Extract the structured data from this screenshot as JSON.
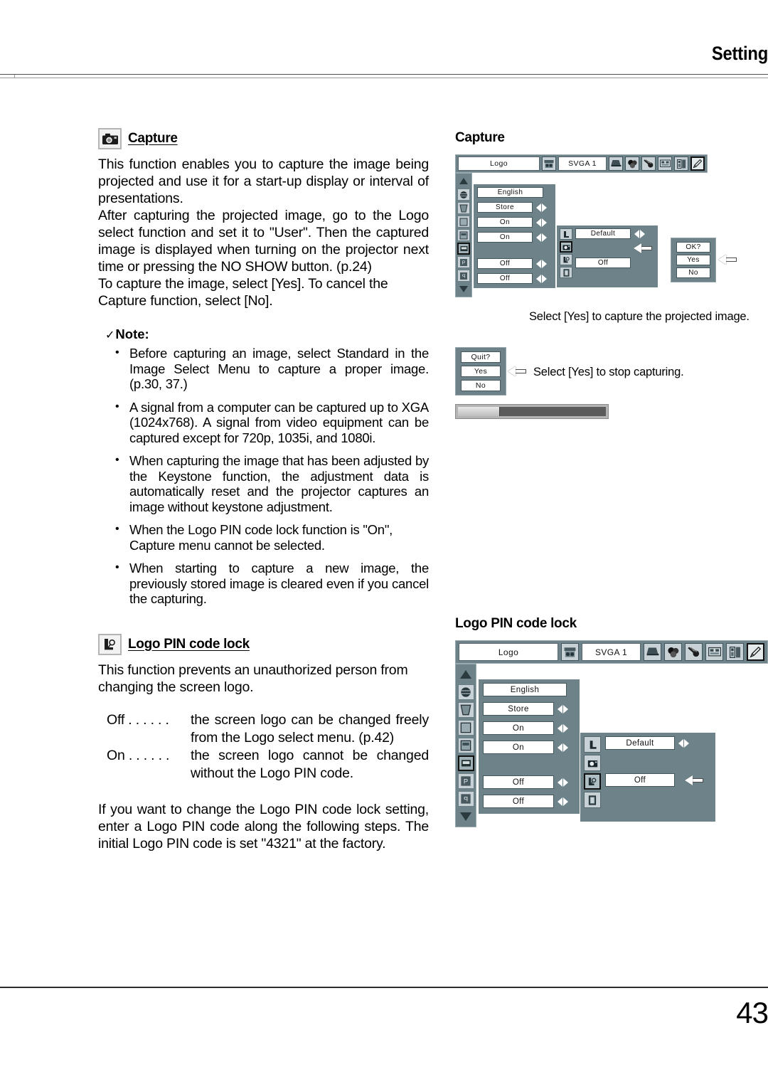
{
  "header": {
    "title": "Setting"
  },
  "footer": {
    "page_number": "43"
  },
  "capture_section": {
    "icon": "camera-icon",
    "heading": "Capture",
    "paragraphs": [
      "This function enables you to capture the image being projected and use it for a start-up display or interval of presentations.",
      "After capturing the projected image, go to the Logo select function and set it to \"User\".  Then the captured image is displayed when turning on the projector next time or pressing the NO SHOW button. (p.24)",
      "To capture the image, select [Yes].  To cancel the Capture function, select [No]."
    ]
  },
  "note": {
    "check_mark": "✓",
    "heading": "Note:",
    "items": [
      "Before capturing an image, select Standard in the Image Select Menu to capture a proper image. (p.30, 37.)",
      "A signal from a computer can be captured up to XGA (1024x768).  A signal from video equipment can be captured except for 720p, 1035i, and 1080i.",
      "When capturing the image that has been adjusted by the Keystone function, the adjustment data is automatically reset and the projector captures an image without keystone adjustment.",
      "When the Logo PIN code lock function is \"On\", Capture menu cannot be selected.",
      "When starting to capture a new image, the previously stored image is cleared even if you cancel the capturing."
    ]
  },
  "logo_pin_section": {
    "icon": "logo-pin-lock-icon",
    "heading": "Logo PIN code lock",
    "intro": "This function prevents an unauthorized person from changing the screen logo.",
    "definitions": [
      {
        "term": "Off . . . . . .",
        "desc": "the screen logo can be changed freely from the Logo select menu. (p.42)"
      },
      {
        "term": "On . . . . . .",
        "desc": "the screen logo cannot be changed without the Logo PIN code."
      }
    ],
    "outro": "If you want to change the Logo PIN code lock setting, enter a Logo PIN code along the following steps.  The initial Logo PIN code is set \"4321\" at the factory."
  },
  "figures": {
    "capture": {
      "title": "Capture",
      "menu": {
        "topbar": {
          "menu_name": "Logo",
          "source_name": "SVGA 1",
          "source_icon": "input-source-icon",
          "tools": [
            {
              "name": "computer-icon",
              "selected": false
            },
            {
              "name": "color-adjust-icon",
              "selected": false
            },
            {
              "name": "image-adjust-icon",
              "selected": false
            },
            {
              "name": "screen-icon",
              "selected": false
            },
            {
              "name": "sound-icon",
              "selected": false
            },
            {
              "name": "setting-pencil-icon",
              "selected": true
            }
          ]
        },
        "rail": [
          {
            "name": "scroll-up-icon",
            "selected": false
          },
          {
            "name": "language-globe-icon",
            "selected": false
          },
          {
            "name": "keystone-icon",
            "selected": false
          },
          {
            "name": "blue-back-icon",
            "selected": false
          },
          {
            "name": "display-icon",
            "selected": false
          },
          {
            "name": "logo-icon",
            "selected": true
          },
          {
            "name": "ceiling-icon",
            "selected": false
          },
          {
            "name": "rear-icon",
            "selected": false
          },
          {
            "name": "scroll-down-icon",
            "selected": false
          }
        ],
        "rows": [
          {
            "value": "English",
            "arrows": false
          },
          {
            "value": "Store",
            "arrows": true
          },
          {
            "value": "On",
            "arrows": true
          },
          {
            "value": "On",
            "arrows": true
          },
          {
            "value": "Off",
            "arrows": true
          },
          {
            "value": "Off",
            "arrows": true
          }
        ],
        "sub_panel": {
          "icons": [
            {
              "name": "logo-select-L-icon",
              "selected": false
            },
            {
              "name": "capture-camera-icon",
              "selected": true
            },
            {
              "name": "logo-pin-lock-icon",
              "selected": false
            },
            {
              "name": "logo-pin-code-icon",
              "selected": false
            }
          ],
          "rows": [
            {
              "value": "Default",
              "arrows": true
            },
            {
              "value": "",
              "arrows": false,
              "pointer": true
            },
            {
              "value": "Off",
              "arrows": false
            },
            {
              "value": "",
              "arrows": false
            }
          ]
        },
        "confirm_dialog": {
          "title": "OK?",
          "yes": "Yes",
          "no": "No",
          "pointer_on": "Yes"
        }
      },
      "caption_1": "Select [Yes] to capture the projected image.",
      "quit_dialog": {
        "title": "Quit?",
        "yes": "Yes",
        "no": "No",
        "pointer_on": "Yes"
      },
      "caption_2": "Select [Yes] to stop capturing.",
      "progress": {
        "percent": 28
      }
    },
    "logo_pin": {
      "title": "Logo PIN code lock",
      "menu": {
        "topbar": {
          "menu_name": "Logo",
          "source_name": "SVGA 1",
          "source_icon": "input-source-icon",
          "tools": [
            {
              "name": "computer-icon",
              "selected": false
            },
            {
              "name": "color-adjust-icon",
              "selected": false
            },
            {
              "name": "image-adjust-icon",
              "selected": false
            },
            {
              "name": "screen-icon",
              "selected": false
            },
            {
              "name": "sound-icon",
              "selected": false
            },
            {
              "name": "setting-pencil-icon",
              "selected": true
            }
          ]
        },
        "rail": [
          {
            "name": "scroll-up-icon",
            "selected": false
          },
          {
            "name": "language-globe-icon",
            "selected": false
          },
          {
            "name": "keystone-icon",
            "selected": false
          },
          {
            "name": "blue-back-icon",
            "selected": false
          },
          {
            "name": "display-icon",
            "selected": false
          },
          {
            "name": "logo-icon",
            "selected": true
          },
          {
            "name": "ceiling-icon",
            "selected": false
          },
          {
            "name": "rear-icon",
            "selected": false
          },
          {
            "name": "scroll-down-icon",
            "selected": false
          }
        ],
        "rows": [
          {
            "value": "English",
            "arrows": false
          },
          {
            "value": "Store",
            "arrows": true
          },
          {
            "value": "On",
            "arrows": true
          },
          {
            "value": "On",
            "arrows": true
          },
          {
            "value": "Off",
            "arrows": true
          },
          {
            "value": "Off",
            "arrows": true
          }
        ],
        "sub_panel": {
          "icons": [
            {
              "name": "logo-select-L-icon",
              "selected": false
            },
            {
              "name": "capture-camera-icon",
              "selected": false
            },
            {
              "name": "logo-pin-lock-icon",
              "selected": true
            },
            {
              "name": "logo-pin-code-icon",
              "selected": false
            }
          ],
          "rows": [
            {
              "value": "Default",
              "arrows": true
            },
            {
              "value": "",
              "arrows": false
            },
            {
              "value": "Off",
              "arrows": false,
              "pointer": true
            },
            {
              "value": "",
              "arrows": false
            }
          ]
        }
      }
    }
  },
  "colors": {
    "osd_panel": "#6d8289",
    "osd_field": "#ffffff",
    "osd_icon": "#c8d2d6",
    "rule": "#4d4d4d"
  }
}
